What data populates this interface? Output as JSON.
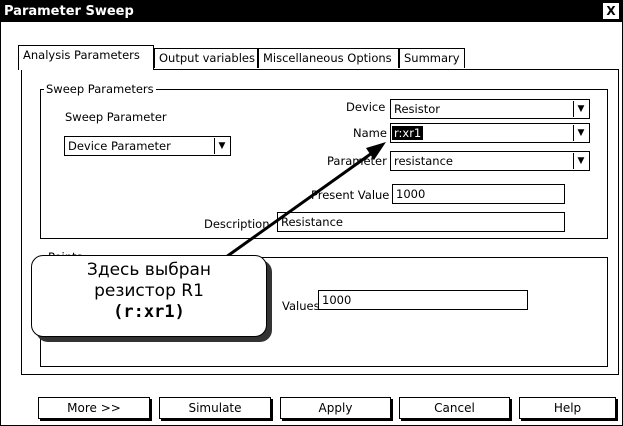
{
  "window": {
    "title": "Parameter Sweep",
    "close_glyph": "X"
  },
  "tabs": [
    {
      "label": "Analysis Parameters",
      "active": true
    },
    {
      "label": "Output variables",
      "active": false
    },
    {
      "label": "Miscellaneous Options",
      "active": false
    },
    {
      "label": "Summary",
      "active": false
    }
  ],
  "sweep_params": {
    "group_label": "Sweep Parameters",
    "sweep_param_label": "Sweep Parameter",
    "sweep_param_value": "Device Parameter",
    "device_label": "Device",
    "device_value": "Resistor",
    "name_label": "Name",
    "name_value": "r:xr1",
    "parameter_label": "Parameter",
    "parameter_value": "resistance",
    "present_value_label": "Present Value",
    "present_value": "1000",
    "description_label": "Description",
    "description_value": "Resistance"
  },
  "points": {
    "group_label": "Points",
    "values_label": "Values",
    "values_value": "1000"
  },
  "buttons": {
    "more": "More >>",
    "simulate": "Simulate",
    "apply": "Apply",
    "cancel": "Cancel",
    "help": "Help"
  },
  "callout": {
    "line1": "Здесь выбран",
    "line2": "резистор R1",
    "line3": "(r:xr1)"
  }
}
